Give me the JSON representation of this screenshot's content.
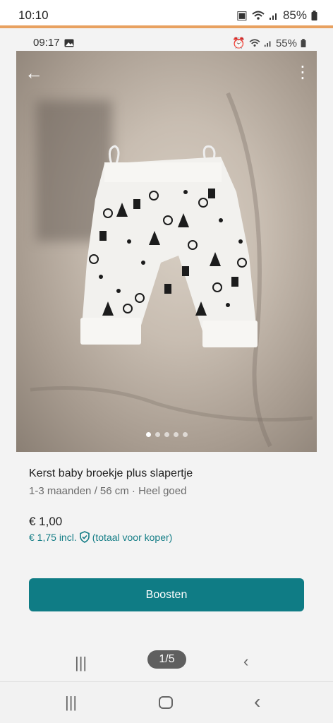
{
  "outer_status": {
    "time": "10:10",
    "battery": "85%"
  },
  "inner_status": {
    "time": "09:17",
    "battery": "55%"
  },
  "carousel": {
    "total": 5,
    "active_index": 0
  },
  "listing": {
    "title": "Kerst baby broekje plus slapertje",
    "subtitle": "1-3 maanden / 56 cm · Heel goed",
    "price": "€ 1,00",
    "price_incl": "€ 1,75  incl.",
    "price_incl_note": "(totaal voor koper)"
  },
  "actions": {
    "boost_label": "Boosten"
  },
  "pager": {
    "label": "1/5"
  },
  "icons": [
    "back-arrow-icon",
    "more-vertical-icon",
    "shield-check-icon",
    "recents-icon",
    "home-icon",
    "back-icon"
  ],
  "colors": {
    "accent": "#0f7c85",
    "link": "#147d86",
    "status_line": "#e8a160"
  }
}
